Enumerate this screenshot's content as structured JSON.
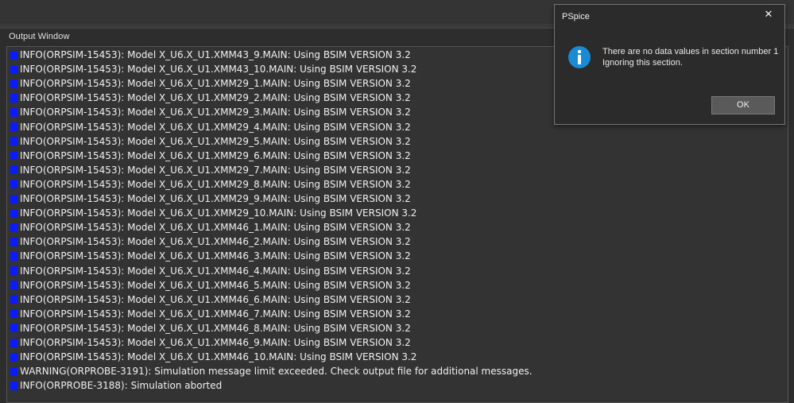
{
  "output_window": {
    "title": "Output Window",
    "log_marker_color": "#0a1bff",
    "lines": [
      "INFO(ORPSIM-15453): Model X_U6.X_U1.XMM43_9.MAIN: Using BSIM VERSION 3.2",
      "INFO(ORPSIM-15453): Model X_U6.X_U1.XMM43_10.MAIN: Using BSIM VERSION 3.2",
      "INFO(ORPSIM-15453): Model X_U6.X_U1.XMM29_1.MAIN: Using BSIM VERSION 3.2",
      "INFO(ORPSIM-15453): Model X_U6.X_U1.XMM29_2.MAIN: Using BSIM VERSION 3.2",
      "INFO(ORPSIM-15453): Model X_U6.X_U1.XMM29_3.MAIN: Using BSIM VERSION 3.2",
      "INFO(ORPSIM-15453): Model X_U6.X_U1.XMM29_4.MAIN: Using BSIM VERSION 3.2",
      "INFO(ORPSIM-15453): Model X_U6.X_U1.XMM29_5.MAIN: Using BSIM VERSION 3.2",
      "INFO(ORPSIM-15453): Model X_U6.X_U1.XMM29_6.MAIN: Using BSIM VERSION 3.2",
      "INFO(ORPSIM-15453): Model X_U6.X_U1.XMM29_7.MAIN: Using BSIM VERSION 3.2",
      "INFO(ORPSIM-15453): Model X_U6.X_U1.XMM29_8.MAIN: Using BSIM VERSION 3.2",
      "INFO(ORPSIM-15453): Model X_U6.X_U1.XMM29_9.MAIN: Using BSIM VERSION 3.2",
      "INFO(ORPSIM-15453): Model X_U6.X_U1.XMM29_10.MAIN: Using BSIM VERSION 3.2",
      "INFO(ORPSIM-15453): Model X_U6.X_U1.XMM46_1.MAIN: Using BSIM VERSION 3.2",
      "INFO(ORPSIM-15453): Model X_U6.X_U1.XMM46_2.MAIN: Using BSIM VERSION 3.2",
      "INFO(ORPSIM-15453): Model X_U6.X_U1.XMM46_3.MAIN: Using BSIM VERSION 3.2",
      "INFO(ORPSIM-15453): Model X_U6.X_U1.XMM46_4.MAIN: Using BSIM VERSION 3.2",
      "INFO(ORPSIM-15453): Model X_U6.X_U1.XMM46_5.MAIN: Using BSIM VERSION 3.2",
      "INFO(ORPSIM-15453): Model X_U6.X_U1.XMM46_6.MAIN: Using BSIM VERSION 3.2",
      "INFO(ORPSIM-15453): Model X_U6.X_U1.XMM46_7.MAIN: Using BSIM VERSION 3.2",
      "INFO(ORPSIM-15453): Model X_U6.X_U1.XMM46_8.MAIN: Using BSIM VERSION 3.2",
      "INFO(ORPSIM-15453): Model X_U6.X_U1.XMM46_9.MAIN: Using BSIM VERSION 3.2",
      "INFO(ORPSIM-15453): Model X_U6.X_U1.XMM46_10.MAIN: Using BSIM VERSION 3.2",
      "WARNING(ORPROBE-3191): Simulation message limit exceeded. Check output file for additional messages.",
      "INFO(ORPROBE-3188): Simulation aborted"
    ]
  },
  "dialog": {
    "title": "PSpice",
    "close_icon": "close-icon",
    "icon": "info-icon",
    "icon_color": "#1a8ad4",
    "message_line1": "There are no data values in section number 1",
    "message_line2": "Ignoring this section.",
    "ok_label": "OK"
  }
}
